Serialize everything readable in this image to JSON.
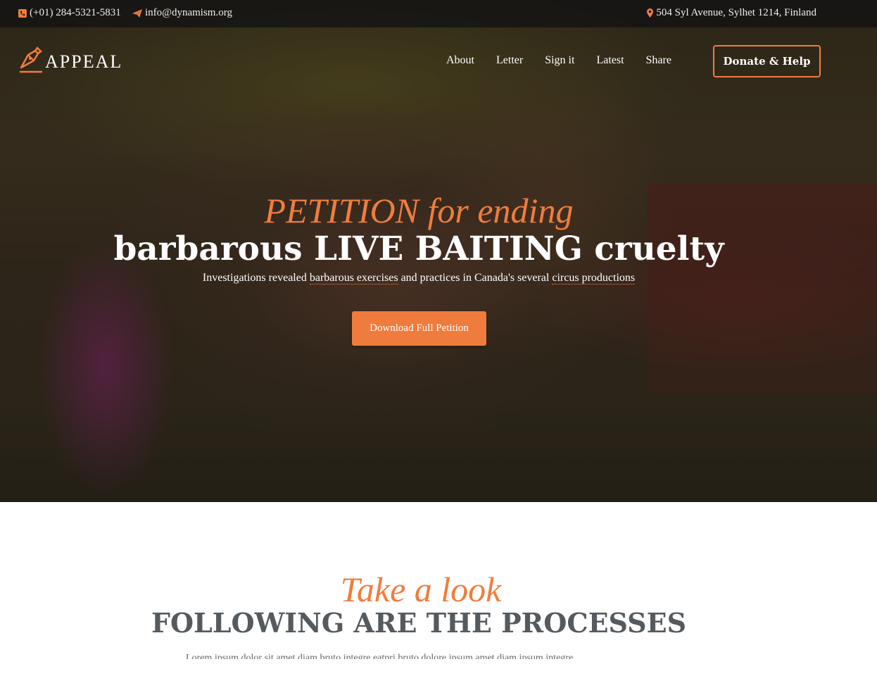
{
  "topbar": {
    "phone": "(+01) 284-5321-5831",
    "email": "info@dynamism.org",
    "address": "504 Syl Avenue, Sylhet 1214, Finland",
    "icons": {
      "phone": "phone-icon",
      "email": "paper-plane-icon",
      "address": "map-pin-icon"
    }
  },
  "header": {
    "logo_text": "APPEAL",
    "nav": [
      "About",
      "Letter",
      "Sign it",
      "Latest",
      "Share"
    ],
    "donate_label": "Donate & Help"
  },
  "hero": {
    "subtitle": "PETITION for ending",
    "title": "barbarous LIVE BAITING cruelty",
    "desc_part1": "Investigations revealed ",
    "desc_link1": "barbarous exercises",
    "desc_part2": " and practices in Canada's several ",
    "desc_link2": "circus productions",
    "button_label": "Download Full Petition"
  },
  "processes": {
    "subtitle": "Take a look",
    "title": "FOLLOWING ARE THE PROCESSES",
    "text": "Lorem ipsum dolor sit amet diam bruto integre eatpri bruto dolore ipsum amet diam ipsum integre"
  },
  "colors": {
    "accent": "#f07d3e",
    "topbar_bg": "#141414",
    "title_gray": "#555a5e"
  }
}
